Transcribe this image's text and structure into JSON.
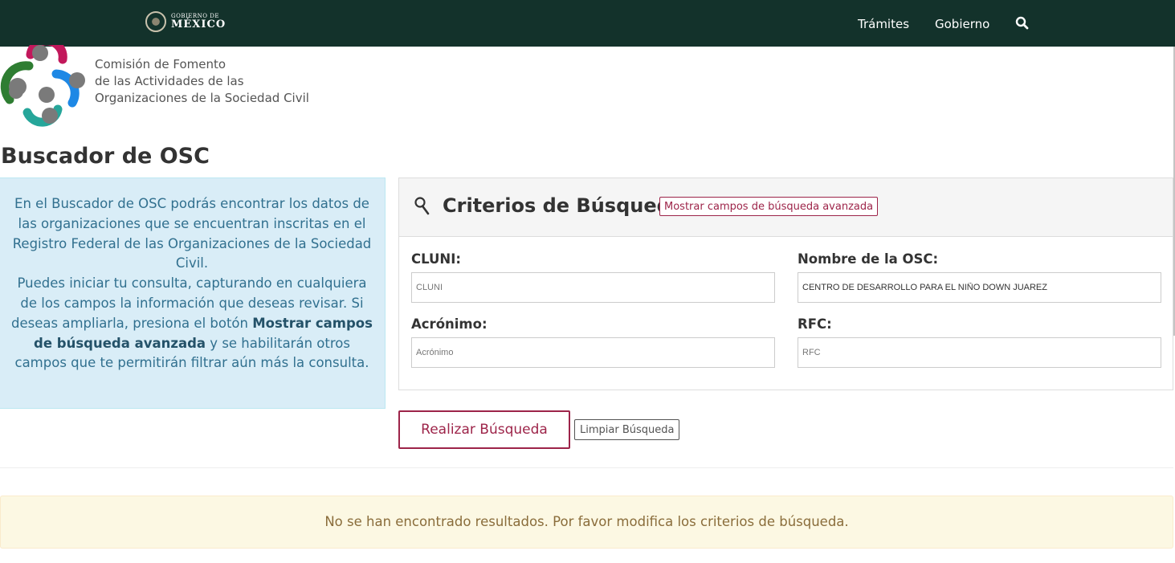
{
  "header": {
    "gov_logo_line1": "GOBIERNO DE",
    "gov_logo_line2": "MÉXICO",
    "nav": [
      "Trámites",
      "Gobierno"
    ],
    "bg_color": "#13322b"
  },
  "org": {
    "name_line1": "Comisión de Fomento",
    "name_line2": "de las Actividades de las",
    "name_line3": "Organizaciones de la Sociedad Civil",
    "logo_colors": [
      "#c2185b",
      "#2e7d32",
      "#1e88e5",
      "#26a69a",
      "#7a7a7a"
    ]
  },
  "page": {
    "title": "Buscador de OSC"
  },
  "info": {
    "p1": "En el Buscador de OSC podrás encontrar los datos de las organizaciones que se encuentran inscritas en el Registro Federal de las Organizaciones de la Sociedad Civil.",
    "p2_before": "Puedes iniciar tu consulta, capturando en cualquiera de los campos la información que deseas revisar. Si deseas ampliarla, presiona el botón ",
    "p2_bold": "Mostrar campos de búsqueda avanzada",
    "p2_after": " y se habilitarán otros campos que te permitirán filtrar aún más la consulta."
  },
  "search": {
    "title": "Criterios de Búsqueda",
    "advanced_label": "Mostrar campos de búsqueda avanzada",
    "fields": {
      "cluni": {
        "label": "CLUNI:",
        "placeholder": "CLUNI",
        "value": ""
      },
      "nombre": {
        "label": "Nombre de la OSC:",
        "placeholder": "",
        "value": "CENTRO DE DESARROLLO PARA EL NIÑO DOWN JUAREZ"
      },
      "acronimo": {
        "label": "Acrónimo:",
        "placeholder": "Acrónimo",
        "value": ""
      },
      "rfc": {
        "label": "RFC:",
        "placeholder": "RFC",
        "value": ""
      }
    },
    "submit_label": "Realizar Búsqueda",
    "clear_label": "Limpiar Búsqueda",
    "accent_color": "#9d2449"
  },
  "results": {
    "message": "No se han encontrado resultados. Por favor modifica los criterios de búsqueda."
  }
}
